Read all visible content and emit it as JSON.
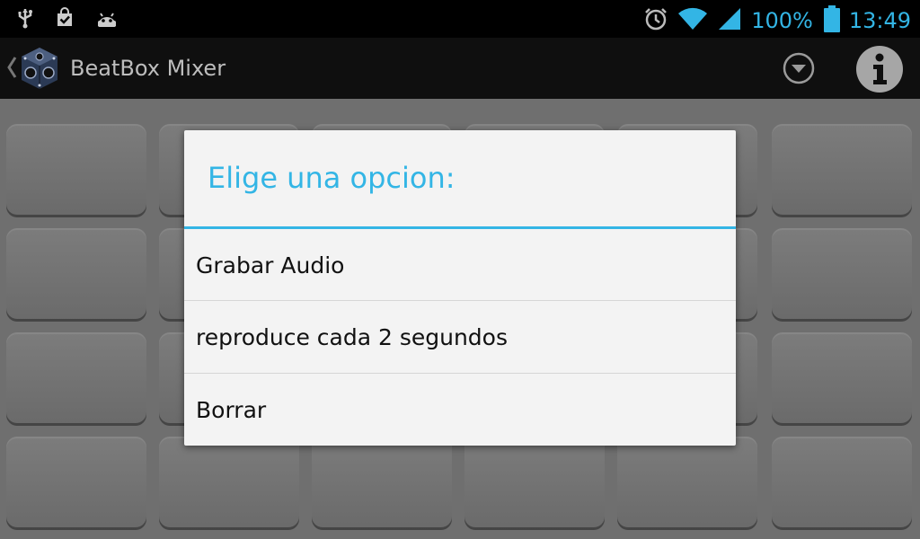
{
  "status_bar": {
    "icons_left": [
      "usb-icon",
      "shopping-bag-check-icon",
      "android-icon"
    ],
    "icons_right": [
      "alarm-icon",
      "wifi-icon",
      "signal-icon",
      "battery-icon"
    ],
    "battery_percent": "100%",
    "time": "13:49",
    "accent": "#33b5e5"
  },
  "action_bar": {
    "title": "BeatBox Mixer",
    "icons": [
      "back-chevron-icon",
      "app-logo-icon",
      "overflow-dropdown-icon",
      "info-icon"
    ]
  },
  "dialog": {
    "title": "Elige una opcion:",
    "options": [
      "Grabar Audio",
      "reproduce cada 2 segundos",
      "Borrar"
    ],
    "accent": "#33b5e5"
  }
}
